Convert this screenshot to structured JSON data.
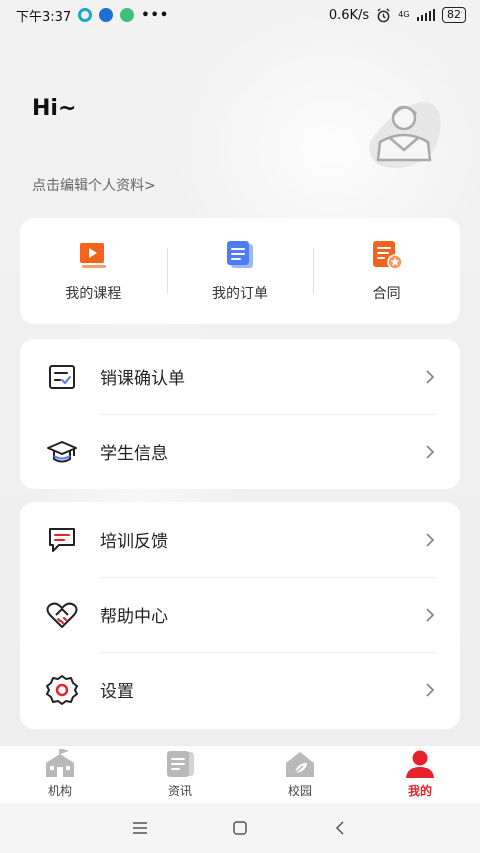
{
  "status_bar": {
    "time": "下午3:37",
    "dots": "•••",
    "net_speed": "0.6K/s",
    "network": "4G",
    "battery": "82"
  },
  "profile": {
    "greeting": "Hi~",
    "edit_link": "点击编辑个人资料>"
  },
  "quick_actions": [
    {
      "label": "我的课程",
      "icon": "course-video-icon"
    },
    {
      "label": "我的订单",
      "icon": "order-document-icon"
    },
    {
      "label": "合同",
      "icon": "contract-icon"
    }
  ],
  "menu_group_1": [
    {
      "label": "销课确认单",
      "icon": "checklist-icon"
    },
    {
      "label": "学生信息",
      "icon": "graduation-cap-icon"
    }
  ],
  "menu_group_2": [
    {
      "label": "培训反馈",
      "icon": "feedback-chat-icon"
    },
    {
      "label": "帮助中心",
      "icon": "heart-handshake-icon"
    },
    {
      "label": "设置",
      "icon": "settings-gear-icon"
    }
  ],
  "bottom_nav": [
    {
      "label": "机构",
      "icon": "school-building-icon",
      "active": false
    },
    {
      "label": "资讯",
      "icon": "news-icon",
      "active": false
    },
    {
      "label": "校园",
      "icon": "campus-house-icon",
      "active": false
    },
    {
      "label": "我的",
      "icon": "user-profile-icon",
      "active": true
    }
  ],
  "colors": {
    "accent_red": "#e8222d",
    "orange": "#f2631e",
    "blue": "#4f7cf3"
  }
}
